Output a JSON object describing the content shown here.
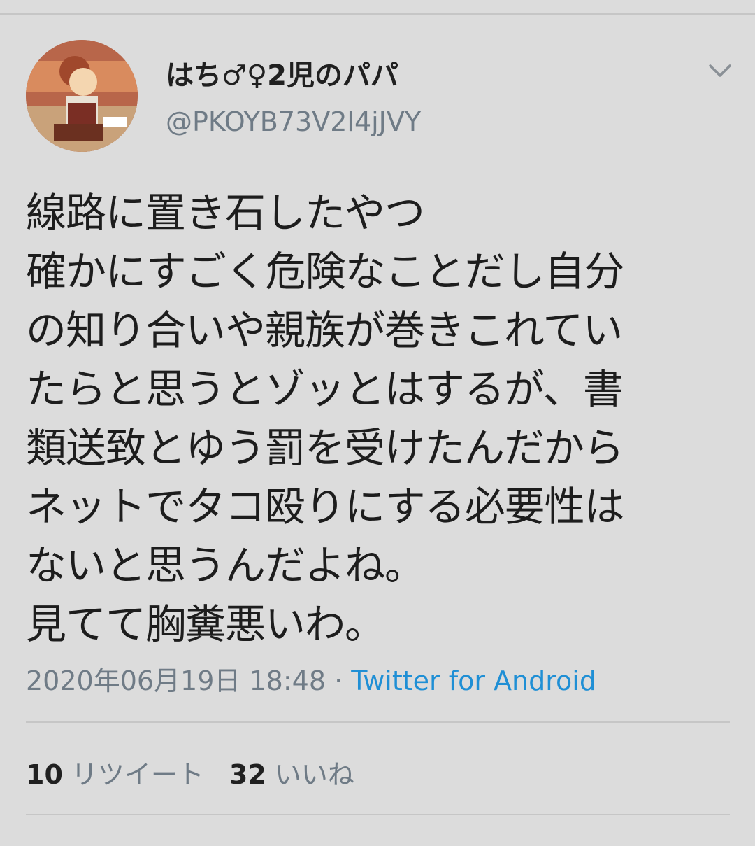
{
  "user": {
    "display_name": "はち♂♀2児のパパ",
    "handle": "@PKOYB73V2l4jJVY",
    "avatar_icon": "avatar-illustration"
  },
  "tweet": {
    "lines": [
      "線路に置き石したやつ",
      "確かにすごく危険なことだし自分",
      "の知り合いや親族が巻きこれてい",
      "たらと思うとゾッとはするが、書",
      "類送致とゆう罰を受けたんだから",
      "ネットでタコ殴りにする必要性は",
      "ないと思うんだよね。",
      "見てて胸糞悪いわ。"
    ],
    "timestamp": "2020年06月19日 18:48",
    "separator": " · ",
    "source": "Twitter for Android"
  },
  "stats": {
    "retweets_count": "10",
    "retweets_label": "リツイート",
    "likes_count": "32",
    "likes_label": "いいね"
  },
  "icons": {
    "menu": "chevron-down-icon"
  },
  "colors": {
    "background": "#dcdcdc",
    "text": "#1d1d1d",
    "secondary": "#6f7b86",
    "link": "#1f8fd5"
  }
}
